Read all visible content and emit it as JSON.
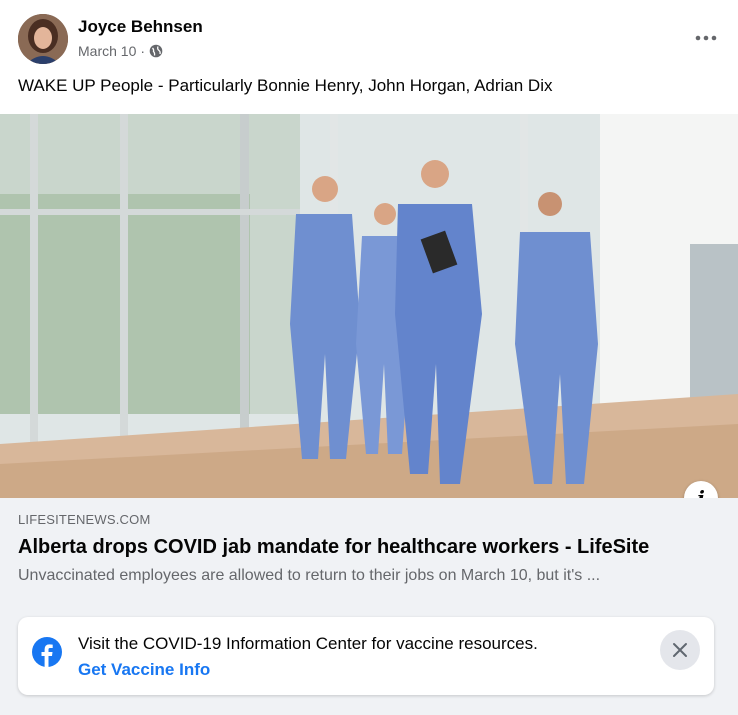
{
  "post": {
    "author": "Joyce Behnsen",
    "date": "March 10",
    "separator": "·",
    "audience_icon": "globe-icon",
    "more_icon": "more-options-icon",
    "text": "WAKE UP People - Particularly Bonnie Henry, John Horgan, Adrian Dix"
  },
  "link_preview": {
    "domain": "LIFESITENEWS.COM",
    "title": "Alberta drops COVID jab mandate for healthcare workers - LifeSite",
    "description": "Unvaccinated employees are allowed to return to their jobs on March 10, but it's ...",
    "info_label": "i"
  },
  "covid_banner": {
    "text": "Visit the COVID-19 Information Center for vaccine resources.",
    "link": "Get Vaccine Info",
    "logo_icon": "facebook-logo-icon",
    "close_icon": "close-icon"
  },
  "colors": {
    "background": "#f0f2f5",
    "link_blue": "#1877f2",
    "secondary_text": "#65676b",
    "scrub_blue": "#6f8fd0"
  }
}
